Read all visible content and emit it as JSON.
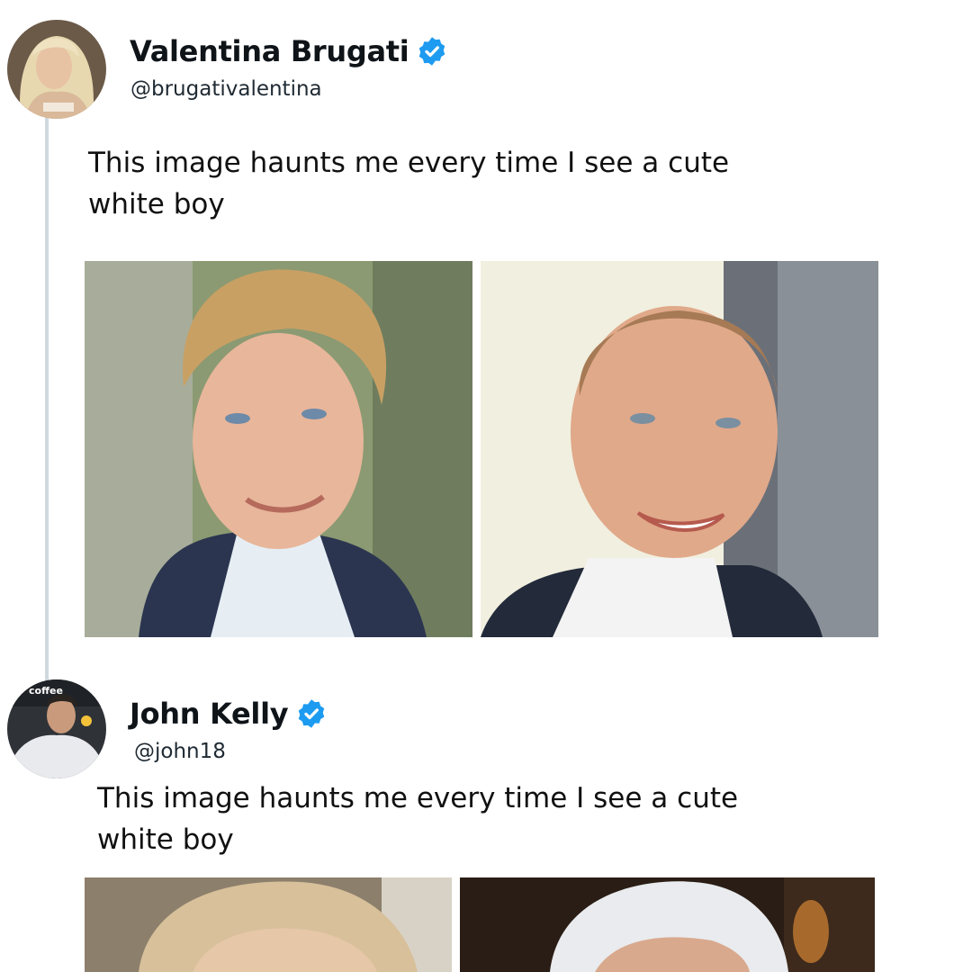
{
  "thread": {
    "tweets": [
      {
        "display_name": "Valentina Brugati",
        "handle": "@brugativalentina",
        "verified": true,
        "text": "This image haunts me every time I see a cute\nwhite boy",
        "media": [
          "young-man-photo",
          "older-bald-man-photo"
        ]
      },
      {
        "display_name": "John Kelly",
        "handle": "@john18",
        "verified": true,
        "avatar_caption": "coffee",
        "text": "This image haunts me every time I see a cute\nwhite boy",
        "media": [
          "blonde-hair-photo",
          "white-hair-photo"
        ]
      }
    ]
  },
  "colors": {
    "verified_badge": "#1d9bf0",
    "thread_line": "#cfd9de",
    "text": "#0f1419"
  }
}
